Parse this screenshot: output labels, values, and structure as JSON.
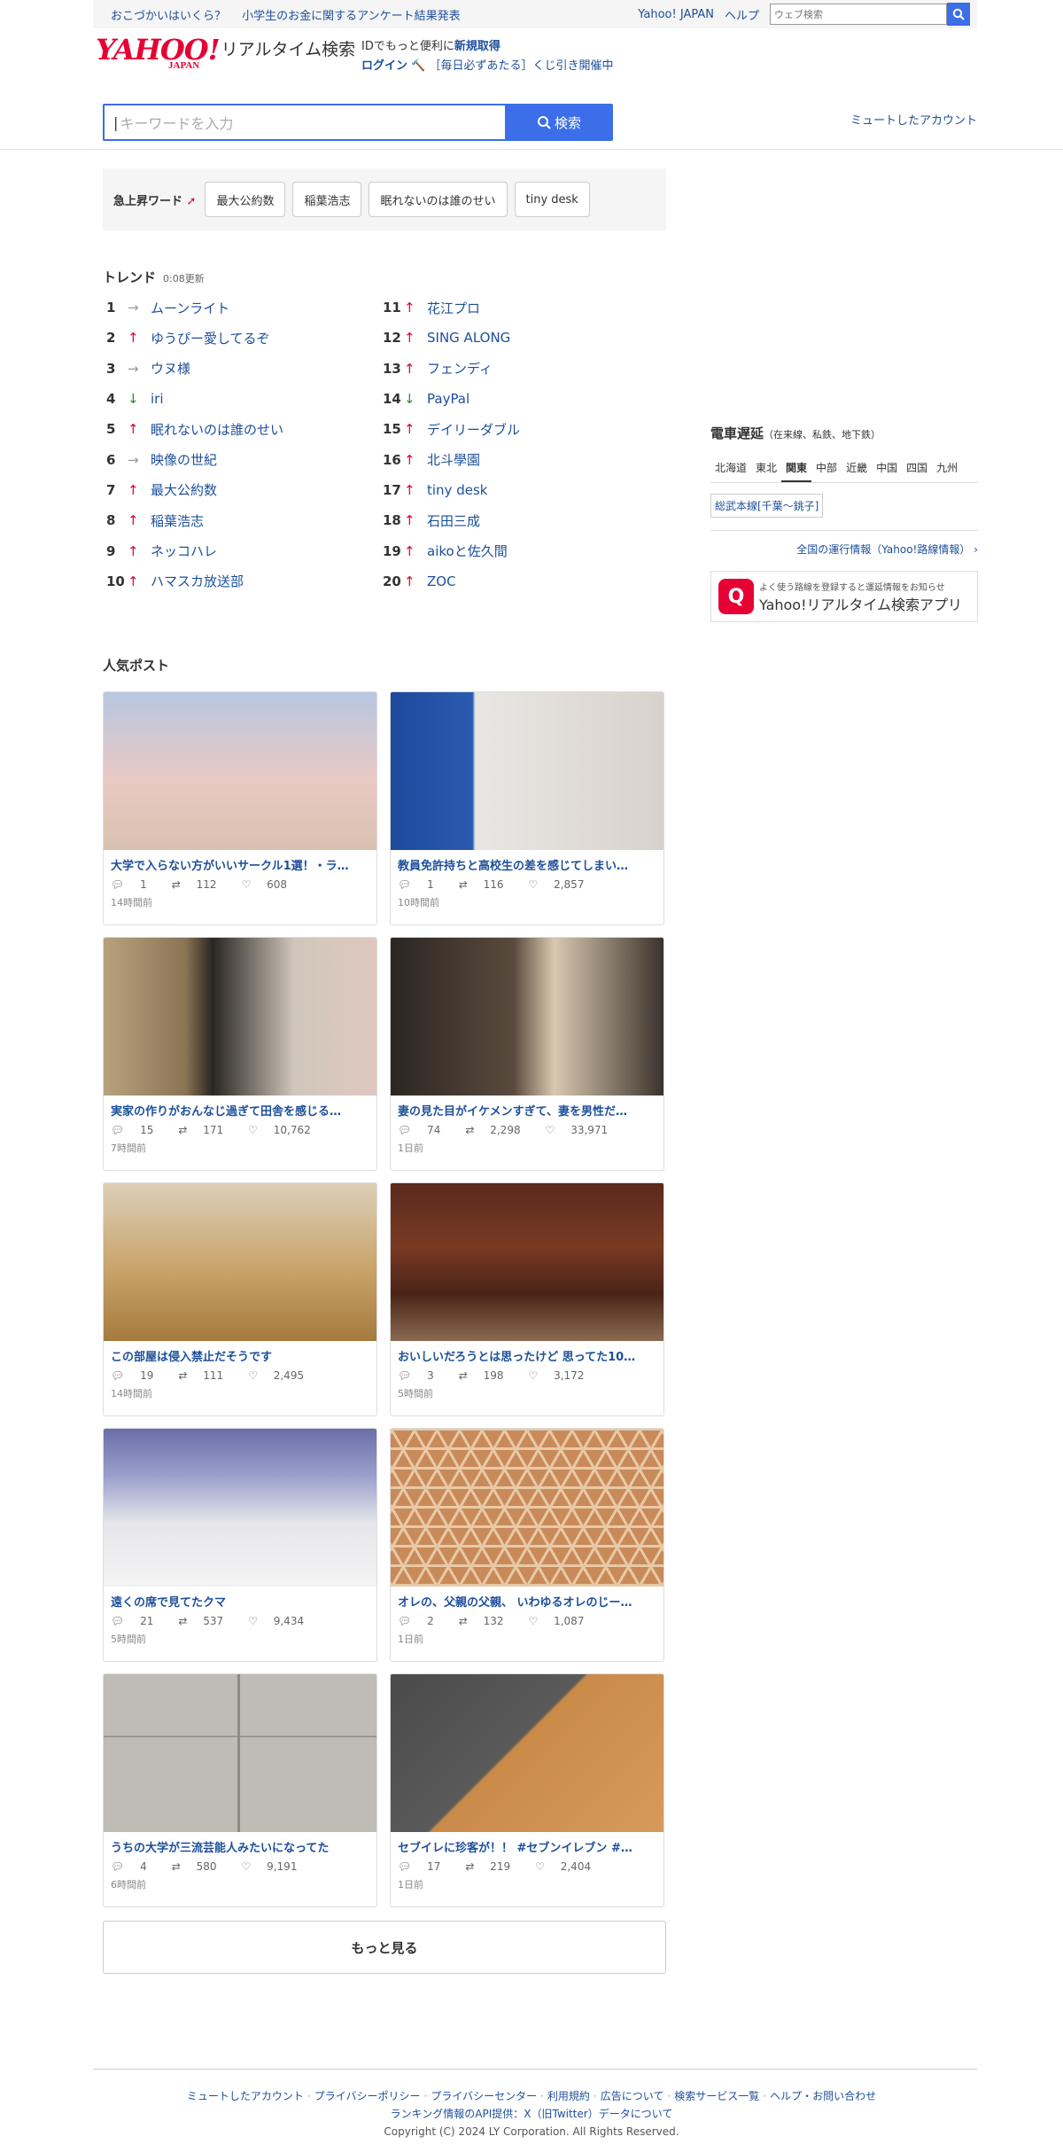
{
  "topbar": {
    "promo1": "おこづかいはいくら？",
    "promo2": "小学生のお金に関するアンケート結果発表",
    "yahoo_japan": "Yahoo! JAPAN",
    "help": "ヘルプ",
    "web_search_placeholder": "ウェブ検索"
  },
  "header": {
    "logo_yahoo": "YAHOO!",
    "logo_japan": "JAPAN",
    "logo_service": "リアルタイム検索",
    "id_text": "IDでもっと便利に",
    "signup": "新規取得",
    "login": "ログイン",
    "lottery": "［毎日必ずあたる］くじ引き開催中",
    "search_placeholder": "キーワードを入力",
    "search_button": "検索",
    "muted_accounts": "ミュートしたアカウント"
  },
  "rising": {
    "label": "急上昇ワード",
    "words": [
      "最大公約数",
      "稲葉浩志",
      "眠れないのは誰のせい",
      "tiny desk"
    ]
  },
  "trends": {
    "title": "トレンド",
    "updated": "0:08更新",
    "left": [
      {
        "rank": "1",
        "dir": "flat",
        "word": "ムーンライト"
      },
      {
        "rank": "2",
        "dir": "up",
        "word": "ゆうぴー愛してるぞ"
      },
      {
        "rank": "3",
        "dir": "flat",
        "word": "ウヌ様"
      },
      {
        "rank": "4",
        "dir": "down",
        "word": "iri"
      },
      {
        "rank": "5",
        "dir": "up",
        "word": "眠れないのは誰のせい"
      },
      {
        "rank": "6",
        "dir": "flat",
        "word": "映像の世紀"
      },
      {
        "rank": "7",
        "dir": "up",
        "word": "最大公約数"
      },
      {
        "rank": "8",
        "dir": "up",
        "word": "稲葉浩志"
      },
      {
        "rank": "9",
        "dir": "up",
        "word": "ネッコハレ"
      },
      {
        "rank": "10",
        "dir": "up",
        "word": "ハマスカ放送部"
      }
    ],
    "right": [
      {
        "rank": "11",
        "dir": "up",
        "word": "花江プロ"
      },
      {
        "rank": "12",
        "dir": "up",
        "word": "SING ALONG"
      },
      {
        "rank": "13",
        "dir": "up",
        "word": "フェンディ"
      },
      {
        "rank": "14",
        "dir": "down",
        "word": "PayPal"
      },
      {
        "rank": "15",
        "dir": "up",
        "word": "デイリーダブル"
      },
      {
        "rank": "16",
        "dir": "up",
        "word": "北斗學園"
      },
      {
        "rank": "17",
        "dir": "up",
        "word": "tiny desk"
      },
      {
        "rank": "18",
        "dir": "up",
        "word": "石田三成"
      },
      {
        "rank": "19",
        "dir": "up",
        "word": "aikoと佐久間"
      },
      {
        "rank": "20",
        "dir": "up",
        "word": "ZOC"
      }
    ]
  },
  "train": {
    "title": "電車遅延",
    "subtitle": "（在来線、私鉄、地下鉄）",
    "regions": [
      "北海道",
      "東北",
      "関東",
      "中部",
      "近畿",
      "中国",
      "四国",
      "九州"
    ],
    "active_region": "関東",
    "line": "総武本線[千葉〜銚子]",
    "info_link": "全国の運行情報（Yahoo!路線情報）",
    "app_small": "よく使う路線を登録すると運延情報をお知らせ",
    "app_name": "Yahoo!リアルタイム検索アプリ"
  },
  "popular": {
    "title": "人気ポスト",
    "posts": [
      {
        "title": "大学で入らない方がいいサークル1選！・ラ…",
        "replies": "1",
        "reposts": "112",
        "likes": "608",
        "ago": "14時間前",
        "img": "sky"
      },
      {
        "title": "教員免許持ちと高校生の差を感じてしまい…",
        "replies": "1",
        "reposts": "116",
        "likes": "2,857",
        "ago": "10時間前",
        "img": "portrait"
      },
      {
        "title": "実家の作りがおんなじ過ぎて田舎を感じる…",
        "replies": "15",
        "reposts": "171",
        "likes": "10,762",
        "ago": "7時間前",
        "img": "room"
      },
      {
        "title": "妻の見た目がイケメンすぎて、妻を男性だ…",
        "replies": "74",
        "reposts": "2,298",
        "likes": "33,971",
        "ago": "1日前",
        "img": "dark"
      },
      {
        "title": "この部屋は侵入禁止だそうです",
        "replies": "19",
        "reposts": "111",
        "likes": "2,495",
        "ago": "14時間前",
        "img": "cat"
      },
      {
        "title": "おいしいだろうとは思ったけど 思ってた10…",
        "replies": "3",
        "reposts": "198",
        "likes": "3,172",
        "ago": "5時間前",
        "img": "choco"
      },
      {
        "title": "遠くの席で見てたクマ",
        "replies": "21",
        "reposts": "537",
        "likes": "9,434",
        "ago": "5時間前",
        "img": "manga"
      },
      {
        "title": "オレの、父親の父親、 いわゆるオレのじー…",
        "replies": "2",
        "reposts": "132",
        "likes": "1,087",
        "ago": "1日前",
        "img": "lattice"
      },
      {
        "title": "うちの大学が三流芸能人みたいになってた",
        "replies": "4",
        "reposts": "580",
        "likes": "9,191",
        "ago": "6時間前",
        "img": "tiles"
      },
      {
        "title": "セブイレに珍客が！！ #セブンイレブン #…",
        "replies": "17",
        "reposts": "219",
        "likes": "2,404",
        "ago": "1日前",
        "img": "mat"
      }
    ],
    "more": "もっと見る"
  },
  "footer": {
    "links": [
      "ミュートしたアカウント",
      "プライバシーポリシー",
      "プライバシーセンター",
      "利用規約",
      "広告について",
      "検索サービス一覧",
      "ヘルプ・お問い合わせ"
    ],
    "line2": "ランキング情報のAPI提供：X（旧Twitter）データについて",
    "copyright": "Copyright (C) 2024 LY Corporation. All Rights Reserved."
  },
  "colors": {
    "brand": "#e60033",
    "accent": "#3b6ee8",
    "link": "#1d4f9b"
  }
}
